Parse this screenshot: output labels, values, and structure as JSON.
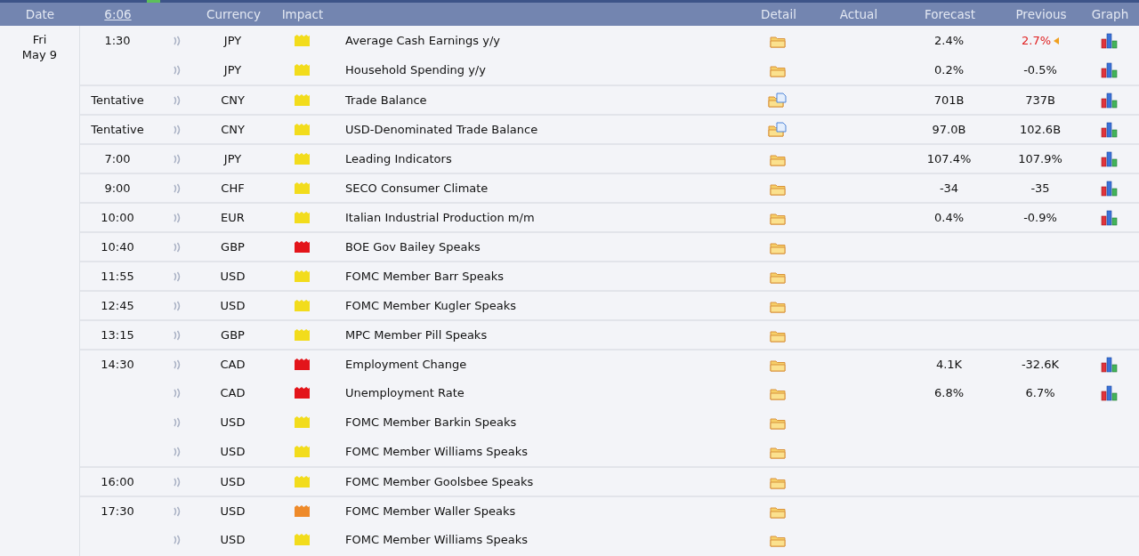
{
  "header": {
    "date": "Date",
    "time": "6:06",
    "currency": "Currency",
    "impact": "Impact",
    "detail": "Detail",
    "actual": "Actual",
    "forecast": "Forecast",
    "previous": "Previous",
    "graph": "Graph"
  },
  "day": {
    "weekday": "Fri",
    "date": "May 9"
  },
  "events": [
    {
      "time": "1:30",
      "currency": "JPY",
      "impact": {
        "color": "#f2dc1c"
      },
      "event": "Average Cash Earnings y/y",
      "detail": {
        "kind": "folder"
      },
      "forecast": "2.4%",
      "previous": "2.7%",
      "revised": true,
      "graph": true
    },
    {
      "currency": "JPY",
      "impact": {
        "color": "#f2dc1c"
      },
      "event": "Household Spending y/y",
      "detail": {
        "kind": "folder"
      },
      "forecast": "0.2%",
      "previous": "-0.5%",
      "revised": false,
      "graph": true
    },
    {
      "time": "Tentative",
      "currency": "CNY",
      "impact": {
        "color": "#f2dc1c"
      },
      "event": "Trade Balance",
      "detail": {
        "kind": "folder-doc"
      },
      "forecast": "701B",
      "previous": "737B",
      "revised": false,
      "graph": true
    },
    {
      "time": "Tentative",
      "currency": "CNY",
      "impact": {
        "color": "#f2dc1c"
      },
      "event": "USD-Denominated Trade Balance",
      "detail": {
        "kind": "folder-doc"
      },
      "forecast": "97.0B",
      "previous": "102.6B",
      "revised": false,
      "graph": true
    },
    {
      "time": "7:00",
      "currency": "JPY",
      "impact": {
        "color": "#f2dc1c"
      },
      "event": "Leading Indicators",
      "detail": {
        "kind": "folder"
      },
      "forecast": "107.4%",
      "previous": "107.9%",
      "revised": false,
      "graph": true
    },
    {
      "time": "9:00",
      "currency": "CHF",
      "impact": {
        "color": "#f2dc1c"
      },
      "event": "SECO Consumer Climate",
      "detail": {
        "kind": "folder"
      },
      "forecast": "-34",
      "previous": "-35",
      "revised": false,
      "graph": true
    },
    {
      "time": "10:00",
      "currency": "EUR",
      "impact": {
        "color": "#f2dc1c"
      },
      "event": "Italian Industrial Production m/m",
      "detail": {
        "kind": "folder"
      },
      "forecast": "0.4%",
      "previous": "-0.9%",
      "revised": false,
      "graph": true
    },
    {
      "time": "10:40",
      "currency": "GBP",
      "impact": {
        "color": "#e3141a"
      },
      "event": "BOE Gov Bailey Speaks",
      "detail": {
        "kind": "folder"
      },
      "graph": false
    },
    {
      "time": "11:55",
      "currency": "USD",
      "impact": {
        "color": "#f2dc1c"
      },
      "event": "FOMC Member Barr Speaks",
      "detail": {
        "kind": "folder"
      },
      "graph": false
    },
    {
      "time": "12:45",
      "currency": "USD",
      "impact": {
        "color": "#f2dc1c"
      },
      "event": "FOMC Member Kugler Speaks",
      "detail": {
        "kind": "folder"
      },
      "graph": false
    },
    {
      "time": "13:15",
      "currency": "GBP",
      "impact": {
        "color": "#f2dc1c"
      },
      "event": "MPC Member Pill Speaks",
      "detail": {
        "kind": "folder"
      },
      "graph": false
    },
    {
      "time": "14:30",
      "currency": "CAD",
      "impact": {
        "color": "#e3141a"
      },
      "event": "Employment Change",
      "detail": {
        "kind": "folder"
      },
      "forecast": "4.1K",
      "previous": "-32.6K",
      "revised": false,
      "graph": true
    },
    {
      "currency": "CAD",
      "impact": {
        "color": "#e3141a"
      },
      "event": "Unemployment Rate",
      "detail": {
        "kind": "folder"
      },
      "forecast": "6.8%",
      "previous": "6.7%",
      "revised": false,
      "graph": true
    },
    {
      "currency": "USD",
      "impact": {
        "color": "#f2dc1c"
      },
      "event": "FOMC Member Barkin Speaks",
      "detail": {
        "kind": "folder"
      },
      "graph": false
    },
    {
      "currency": "USD",
      "impact": {
        "color": "#f2dc1c"
      },
      "event": "FOMC Member Williams Speaks",
      "detail": {
        "kind": "folder"
      },
      "graph": false
    },
    {
      "time": "16:00",
      "currency": "USD",
      "impact": {
        "color": "#f2dc1c"
      },
      "event": "FOMC Member Goolsbee Speaks",
      "detail": {
        "kind": "folder"
      },
      "graph": false
    },
    {
      "time": "17:30",
      "currency": "USD",
      "impact": {
        "color": "#ee8a2a"
      },
      "event": "FOMC Member Waller Speaks",
      "detail": {
        "kind": "folder"
      },
      "graph": false
    },
    {
      "currency": "USD",
      "impact": {
        "color": "#f2dc1c"
      },
      "event": "FOMC Member Williams Speaks",
      "detail": {
        "kind": "folder"
      },
      "graph": false
    }
  ]
}
